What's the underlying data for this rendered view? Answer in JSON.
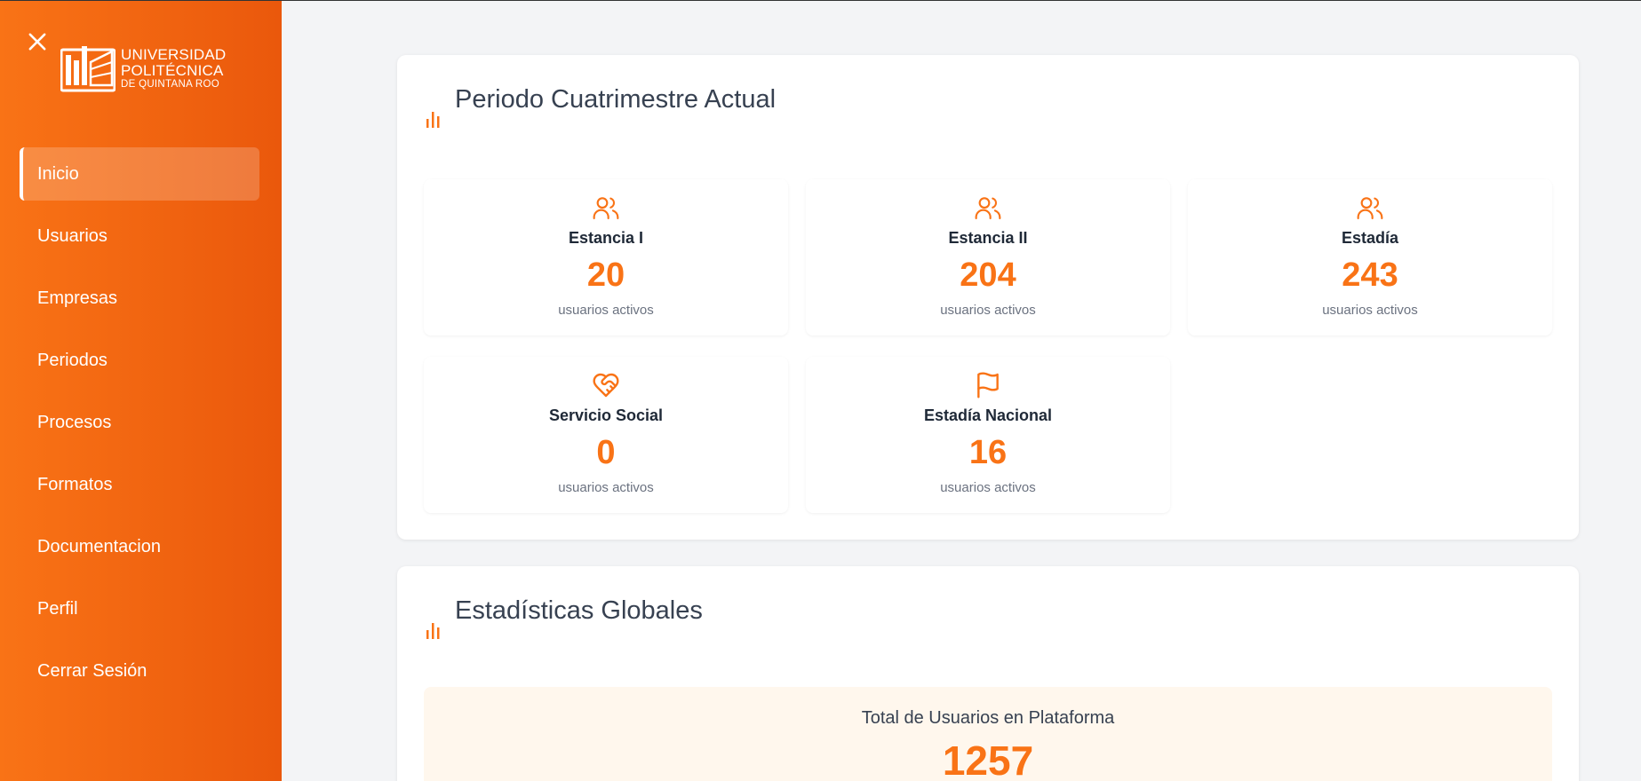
{
  "brand": {
    "line1": "UNIVERSIDAD",
    "line2": "POLITÉCNICA",
    "line3": "DE QUINTANA ROO"
  },
  "sidebar": {
    "items": [
      {
        "label": "Inicio",
        "active": true
      },
      {
        "label": "Usuarios"
      },
      {
        "label": "Empresas"
      },
      {
        "label": "Periodos"
      },
      {
        "label": "Procesos"
      },
      {
        "label": "Formatos"
      },
      {
        "label": "Documentacion"
      },
      {
        "label": "Perfil"
      },
      {
        "label": "Cerrar Sesión"
      }
    ]
  },
  "current_period": {
    "title": "Periodo Cuatrimestre Actual",
    "stats": [
      {
        "label": "Estancia I",
        "value": "20",
        "sub": "usuarios activos",
        "icon": "users-icon"
      },
      {
        "label": "Estancia II",
        "value": "204",
        "sub": "usuarios activos",
        "icon": "users-icon"
      },
      {
        "label": "Estadía",
        "value": "243",
        "sub": "usuarios activos",
        "icon": "users-icon"
      },
      {
        "label": "Servicio Social",
        "value": "0",
        "sub": "usuarios activos",
        "icon": "heart-handshake-icon"
      },
      {
        "label": "Estadía Nacional",
        "value": "16",
        "sub": "usuarios activos",
        "icon": "flag-icon"
      }
    ]
  },
  "global_stats": {
    "title": "Estadísticas Globales",
    "total_label": "Total de Usuarios en Plataforma",
    "total_value": "1257"
  },
  "colors": {
    "accent": "#f97316",
    "sidebar_start": "#f97316",
    "sidebar_end": "#ea580c"
  }
}
